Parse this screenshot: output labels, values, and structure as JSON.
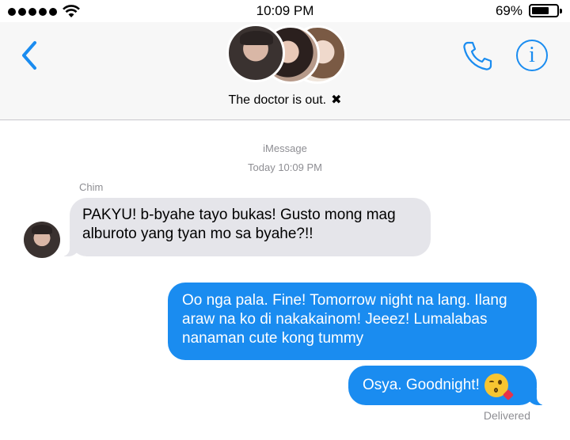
{
  "status_bar": {
    "time": "10:09 PM",
    "battery_percent": "69%",
    "battery_level": 0.69,
    "signal_bars": 5
  },
  "header": {
    "thread_name": "The doctor is out.",
    "close_symbol": "✖",
    "icons": [
      "back-chevron-icon",
      "group-avatar",
      "phone-icon",
      "info-icon"
    ],
    "accent_color": "#1a8cf0"
  },
  "conversation": {
    "service": "iMessage",
    "timestamp": "Today 10:09 PM",
    "sender_name": "Chim",
    "messages": [
      {
        "direction": "incoming",
        "text": "PAKYU! b-byahe tayo bukas! Gusto mong mag alburoto yang tyan mo sa byahe?!!"
      },
      {
        "direction": "outgoing",
        "text": "Oo nga pala. Fine! Tomorrow night na lang. Ilang araw na ko di nakakainom! Jeeez! Lumalabas nanaman cute kong tummy"
      },
      {
        "direction": "outgoing",
        "text": "Osya. Goodnight!",
        "emoji": "face-blowing-a-kiss"
      }
    ],
    "status": "Delivered"
  },
  "colors": {
    "incoming_bubble": "#e5e5ea",
    "outgoing_bubble": "#1a8cf0",
    "meta_text": "#8e8e93"
  }
}
